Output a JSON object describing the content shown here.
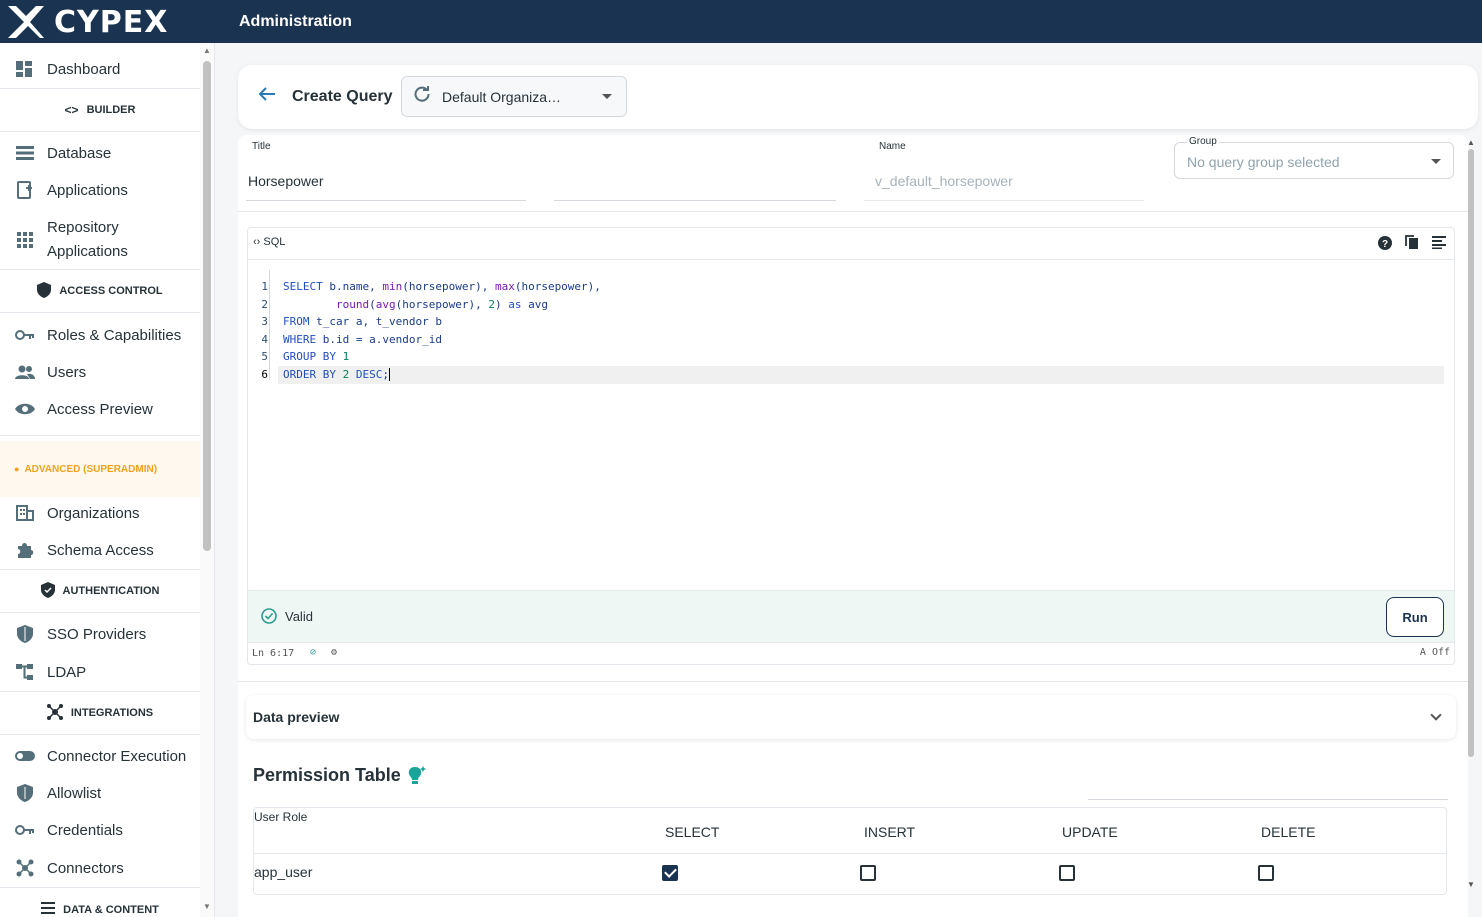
{
  "app": {
    "brand": "CYPEX",
    "title": "Administration"
  },
  "sidebar": {
    "dashboard": "Dashboard",
    "builder": "BUILDER",
    "database": "Database",
    "applications": "Applications",
    "repository_line1": "Repository",
    "repository_line2": "Applications",
    "access_control": "ACCESS CONTROL",
    "roles": "Roles & Capabilities",
    "users": "Users",
    "access_preview": "Access Preview",
    "advanced": "ADVANCED (SUPERADMIN)",
    "organizations": "Organizations",
    "schema_access": "Schema Access",
    "authentication": "AUTHENTICATION",
    "sso": "SSO Providers",
    "ldap": "LDAP",
    "integrations": "INTEGRATIONS",
    "connector_execution": "Connector Execution",
    "allowlist": "Allowlist",
    "credentials": "Credentials",
    "connectors": "Connectors",
    "data_content": "DATA & CONTENT"
  },
  "header": {
    "title": "Create Query",
    "organization": "Default Organiza…"
  },
  "form": {
    "title_label": "Title",
    "title_value": "Horsepower",
    "name_label": "Name",
    "name_value": "v_default_horsepower",
    "group_label": "Group",
    "group_value": "No query group selected"
  },
  "editor": {
    "tag": "SQL",
    "lines": [
      "1",
      "2",
      "3",
      "4",
      "5",
      "6"
    ],
    "status": "Valid",
    "run": "Run",
    "position": "Ln 6:17",
    "off": "Off"
  },
  "preview": {
    "title": "Data preview"
  },
  "permissions": {
    "title": "Permission Table",
    "role_header": "User Role",
    "columns": [
      "SELECT",
      "INSERT",
      "UPDATE",
      "DELETE"
    ],
    "rows": [
      {
        "role": "app_user",
        "select": true,
        "insert": false,
        "update": false,
        "delete": false
      }
    ]
  },
  "colors": {
    "brand": "#1a3350",
    "accent": "#2a7ab8",
    "advanced": "#f2a31b",
    "valid": "#2a9d8f"
  }
}
